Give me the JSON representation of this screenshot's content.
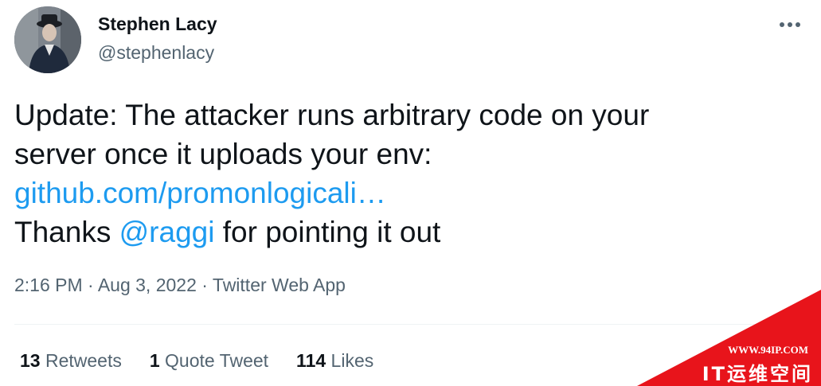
{
  "author": {
    "name": "Stephen Lacy",
    "handle": "@stephenlacy"
  },
  "tweet": {
    "line1": "Update: The attacker runs arbitrary code on your",
    "line2": "server once it uploads your env:",
    "link": "github.com/promonlogicali…",
    "thanks_prefix": "Thanks ",
    "mention": "@raggi",
    "thanks_suffix": " for pointing it out"
  },
  "meta": {
    "time": "2:16 PM",
    "sep1": " · ",
    "date": "Aug 3, 2022",
    "sep2": " · ",
    "source": "Twitter Web App"
  },
  "stats": {
    "retweets_count": "13",
    "retweets_label": " Retweets",
    "quotes_count": "1",
    "quotes_label": " Quote Tweet",
    "likes_count": "114",
    "likes_label": " Likes"
  },
  "watermark": {
    "url": "WWW.94IP.COM",
    "title": "IT运维空间",
    "color": "#e8141b"
  },
  "colors": {
    "text": "#0f1419",
    "secondary": "#536471",
    "link": "#1d9bf0",
    "divider": "#eff3f4"
  },
  "icons": {
    "more": "more-dots-icon"
  }
}
